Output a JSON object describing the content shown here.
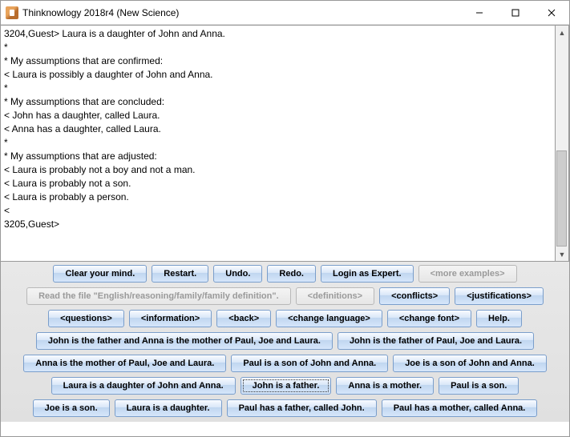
{
  "window": {
    "title": "Thinknowlogy 2018r4 (New Science)"
  },
  "console_text": "3204,Guest> Laura is a daughter of John and Anna.\n*\n* My assumptions that are confirmed:\n< Laura is possibly a daughter of John and Anna.\n*\n* My assumptions that are concluded:\n< John has a daughter, called Laura.\n< Anna has a daughter, called Laura.\n*\n* My assumptions that are adjusted:\n< Laura is probably not a boy and not a man.\n< Laura is probably not a son.\n< Laura is probably a person.\n<\n3205,Guest>",
  "rows": {
    "r1": [
      {
        "id": "clear",
        "label": "Clear your mind.",
        "enabled": true
      },
      {
        "id": "restart",
        "label": "Restart.",
        "enabled": true
      },
      {
        "id": "undo",
        "label": "Undo.",
        "enabled": true
      },
      {
        "id": "redo",
        "label": "Redo.",
        "enabled": true
      },
      {
        "id": "login",
        "label": "Login as Expert.",
        "enabled": true
      },
      {
        "id": "more",
        "label": "<more examples>",
        "enabled": false
      }
    ],
    "r2": [
      {
        "id": "readfile",
        "label": "Read the file \"English/reasoning/family/family definition\".",
        "enabled": false
      },
      {
        "id": "defs",
        "label": "<definitions>",
        "enabled": false
      },
      {
        "id": "conflicts",
        "label": "<conflicts>",
        "enabled": true
      },
      {
        "id": "justif",
        "label": "<justifications>",
        "enabled": true
      }
    ],
    "r3": [
      {
        "id": "questions",
        "label": "<questions>",
        "enabled": true
      },
      {
        "id": "info",
        "label": "<information>",
        "enabled": true
      },
      {
        "id": "back",
        "label": "<back>",
        "enabled": true
      },
      {
        "id": "changelang",
        "label": "<change language>",
        "enabled": true
      },
      {
        "id": "changefont",
        "label": "<change font>",
        "enabled": true
      },
      {
        "id": "help",
        "label": "Help.",
        "enabled": true
      }
    ],
    "r4": [
      {
        "id": "s1",
        "label": "John is the father and Anna is the mother of Paul, Joe and Laura.",
        "enabled": true
      },
      {
        "id": "s2",
        "label": "John is the father of Paul, Joe and Laura.",
        "enabled": true
      }
    ],
    "r5": [
      {
        "id": "s3",
        "label": "Anna is the mother of Paul, Joe and Laura.",
        "enabled": true
      },
      {
        "id": "s4",
        "label": "Paul is a son of John and Anna.",
        "enabled": true
      },
      {
        "id": "s5",
        "label": "Joe is a son of John and Anna.",
        "enabled": true
      }
    ],
    "r6": [
      {
        "id": "s6",
        "label": "Laura is a daughter of John and Anna.",
        "enabled": true
      },
      {
        "id": "s7",
        "label": "John is a father.",
        "enabled": true,
        "focus": true
      },
      {
        "id": "s8",
        "label": "Anna is a mother.",
        "enabled": true
      },
      {
        "id": "s9",
        "label": "Paul is a son.",
        "enabled": true
      }
    ],
    "r7": [
      {
        "id": "s10",
        "label": "Joe is a son.",
        "enabled": true
      },
      {
        "id": "s11",
        "label": "Laura is a daughter.",
        "enabled": true
      },
      {
        "id": "s12",
        "label": "Paul has a father, called John.",
        "enabled": true
      },
      {
        "id": "s13",
        "label": "Paul has a mother, called Anna.",
        "enabled": true
      }
    ]
  }
}
